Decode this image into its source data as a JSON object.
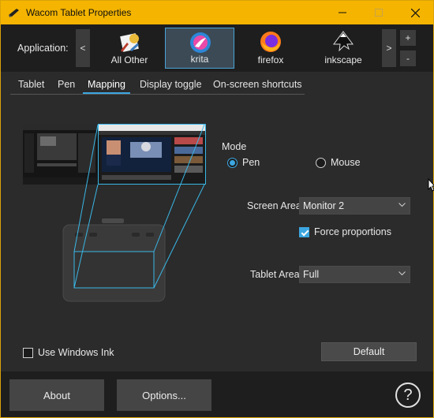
{
  "window": {
    "title": "Wacom Tablet Properties",
    "accent_color": "#f4b400"
  },
  "titlebar_icons": {
    "app": "wacom-pen-icon",
    "minimize": "minimize-icon",
    "maximize": "maximize-icon",
    "close": "close-icon"
  },
  "application_bar": {
    "label": "Application:",
    "scroll_left": "<",
    "scroll_right": ">",
    "add": "+",
    "remove": "-",
    "apps": [
      {
        "label": "All Other",
        "icon": "all-other-apps-icon",
        "selected": false
      },
      {
        "label": "krita",
        "icon": "krita-icon",
        "selected": true
      },
      {
        "label": "firefox",
        "icon": "firefox-icon",
        "selected": false
      },
      {
        "label": "inkscape",
        "icon": "inkscape-icon",
        "selected": false
      }
    ]
  },
  "tabs": [
    {
      "label": "Tablet",
      "active": false
    },
    {
      "label": "Pen",
      "active": false
    },
    {
      "label": "Mapping",
      "active": true
    },
    {
      "label": "Display toggle",
      "active": false
    },
    {
      "label": "On-screen shortcuts",
      "active": false
    }
  ],
  "mapping": {
    "mode_title": "Mode",
    "mode_options": [
      {
        "label": "Pen",
        "selected": true
      },
      {
        "label": "Mouse",
        "selected": false
      }
    ],
    "screen_area_label": "Screen Area:",
    "screen_area_value": "Monitor 2",
    "force_proportions_label": "Force proportions",
    "force_proportions_checked": true,
    "tablet_area_label": "Tablet Area:",
    "tablet_area_value": "Full",
    "use_windows_ink_label": "Use Windows Ink",
    "use_windows_ink_checked": false,
    "default_button": "Default",
    "highlight_color": "#39b7e6"
  },
  "footer": {
    "about_button": "About",
    "options_button": "Options...",
    "help_button": "?"
  }
}
